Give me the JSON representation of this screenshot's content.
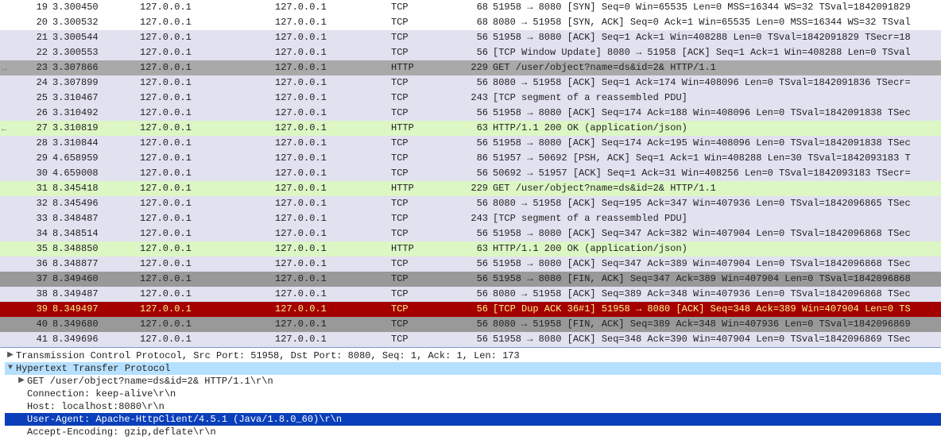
{
  "packets": [
    {
      "no": 19,
      "time": "3.300450",
      "src": "127.0.0.1",
      "dst": "127.0.0.1",
      "proto": "TCP",
      "len": 68,
      "info": "51958 → 8080 [SYN] Seq=0 Win=65535 Len=0 MSS=16344 WS=32 TSval=1842091829",
      "bg": "default"
    },
    {
      "no": 20,
      "time": "3.300532",
      "src": "127.0.0.1",
      "dst": "127.0.0.1",
      "proto": "TCP",
      "len": 68,
      "info": "8080 → 51958 [SYN, ACK] Seq=0 Ack=1 Win=65535 Len=0 MSS=16344 WS=32 TSval",
      "bg": "default"
    },
    {
      "no": 21,
      "time": "3.300544",
      "src": "127.0.0.1",
      "dst": "127.0.0.1",
      "proto": "TCP",
      "len": 56,
      "info": "51958 → 8080 [ACK] Seq=1 Ack=1 Win=408288 Len=0 TSval=1842091829 TSecr=18",
      "bg": "alt"
    },
    {
      "no": 22,
      "time": "3.300553",
      "src": "127.0.0.1",
      "dst": "127.0.0.1",
      "proto": "TCP",
      "len": 56,
      "info": "[TCP Window Update] 8080 → 51958 [ACK] Seq=1 Ack=1 Win=408288 Len=0 TSval",
      "bg": "alt"
    },
    {
      "no": 23,
      "time": "3.307866",
      "src": "127.0.0.1",
      "dst": "127.0.0.1",
      "proto": "HTTP",
      "len": 229,
      "info": "GET /user/object?name=ds&id=2& HTTP/1.1",
      "bg": "sel",
      "arrow": "→"
    },
    {
      "no": 24,
      "time": "3.307899",
      "src": "127.0.0.1",
      "dst": "127.0.0.1",
      "proto": "TCP",
      "len": 56,
      "info": "8080 → 51958 [ACK] Seq=1 Ack=174 Win=408096 Len=0 TSval=1842091836 TSecr=",
      "bg": "alt"
    },
    {
      "no": 25,
      "time": "3.310467",
      "src": "127.0.0.1",
      "dst": "127.0.0.1",
      "proto": "TCP",
      "len": 243,
      "info": "[TCP segment of a reassembled PDU]",
      "bg": "alt"
    },
    {
      "no": 26,
      "time": "3.310492",
      "src": "127.0.0.1",
      "dst": "127.0.0.1",
      "proto": "TCP",
      "len": 56,
      "info": "51958 → 8080 [ACK] Seq=174 Ack=188 Win=408096 Len=0 TSval=1842091838 TSec",
      "bg": "alt"
    },
    {
      "no": 27,
      "time": "3.310819",
      "src": "127.0.0.1",
      "dst": "127.0.0.1",
      "proto": "HTTP",
      "len": 63,
      "info": "HTTP/1.1 200 OK  (application/json)",
      "bg": "http",
      "arrow": "←"
    },
    {
      "no": 28,
      "time": "3.310844",
      "src": "127.0.0.1",
      "dst": "127.0.0.1",
      "proto": "TCP",
      "len": 56,
      "info": "51958 → 8080 [ACK] Seq=174 Ack=195 Win=408096 Len=0 TSval=1842091838 TSec",
      "bg": "alt"
    },
    {
      "no": 29,
      "time": "4.658959",
      "src": "127.0.0.1",
      "dst": "127.0.0.1",
      "proto": "TCP",
      "len": 86,
      "info": "51957 → 50692 [PSH, ACK] Seq=1 Ack=1 Win=408288 Len=30 TSval=1842093183 T",
      "bg": "alt"
    },
    {
      "no": 30,
      "time": "4.659008",
      "src": "127.0.0.1",
      "dst": "127.0.0.1",
      "proto": "TCP",
      "len": 56,
      "info": "50692 → 51957 [ACK] Seq=1 Ack=31 Win=408256 Len=0 TSval=1842093183 TSecr=",
      "bg": "alt"
    },
    {
      "no": 31,
      "time": "8.345418",
      "src": "127.0.0.1",
      "dst": "127.0.0.1",
      "proto": "HTTP",
      "len": 229,
      "info": "GET /user/object?name=ds&id=2& HTTP/1.1",
      "bg": "http"
    },
    {
      "no": 32,
      "time": "8.345496",
      "src": "127.0.0.1",
      "dst": "127.0.0.1",
      "proto": "TCP",
      "len": 56,
      "info": "8080 → 51958 [ACK] Seq=195 Ack=347 Win=407936 Len=0 TSval=1842096865 TSec",
      "bg": "alt"
    },
    {
      "no": 33,
      "time": "8.348487",
      "src": "127.0.0.1",
      "dst": "127.0.0.1",
      "proto": "TCP",
      "len": 243,
      "info": "[TCP segment of a reassembled PDU]",
      "bg": "alt"
    },
    {
      "no": 34,
      "time": "8.348514",
      "src": "127.0.0.1",
      "dst": "127.0.0.1",
      "proto": "TCP",
      "len": 56,
      "info": "51958 → 8080 [ACK] Seq=347 Ack=382 Win=407904 Len=0 TSval=1842096868 TSec",
      "bg": "alt"
    },
    {
      "no": 35,
      "time": "8.348850",
      "src": "127.0.0.1",
      "dst": "127.0.0.1",
      "proto": "HTTP",
      "len": 63,
      "info": "HTTP/1.1 200 OK  (application/json)",
      "bg": "http"
    },
    {
      "no": 36,
      "time": "8.348877",
      "src": "127.0.0.1",
      "dst": "127.0.0.1",
      "proto": "TCP",
      "len": 56,
      "info": "51958 → 8080 [ACK] Seq=347 Ack=389 Win=407904 Len=0 TSval=1842096868 TSec",
      "bg": "alt"
    },
    {
      "no": 37,
      "time": "8.349460",
      "src": "127.0.0.1",
      "dst": "127.0.0.1",
      "proto": "TCP",
      "len": 56,
      "info": "51958 → 8080 [FIN, ACK] Seq=347 Ack=389 Win=407904 Len=0 TSval=1842096868",
      "bg": "gray"
    },
    {
      "no": 38,
      "time": "8.349487",
      "src": "127.0.0.1",
      "dst": "127.0.0.1",
      "proto": "TCP",
      "len": 56,
      "info": "8080 → 51958 [ACK] Seq=389 Ack=348 Win=407936 Len=0 TSval=1842096868 TSec",
      "bg": "alt"
    },
    {
      "no": 39,
      "time": "8.349497",
      "src": "127.0.0.1",
      "dst": "127.0.0.1",
      "proto": "TCP",
      "len": 56,
      "info": "[TCP Dup ACK 36#1] 51958 → 8080 [ACK] Seq=348 Ack=389 Win=407904 Len=0 TS",
      "bg": "red"
    },
    {
      "no": 40,
      "time": "8.349680",
      "src": "127.0.0.1",
      "dst": "127.0.0.1",
      "proto": "TCP",
      "len": 56,
      "info": "8080 → 51958 [FIN, ACK] Seq=389 Ack=348 Win=407936 Len=0 TSval=1842096869",
      "bg": "gray"
    },
    {
      "no": 41,
      "time": "8.349696",
      "src": "127.0.0.1",
      "dst": "127.0.0.1",
      "proto": "TCP",
      "len": 56,
      "info": "51958 → 8080 [ACK] Seq=348 Ack=390 Win=407904 Len=0 TSval=1842096869 TSec",
      "bg": "alt"
    }
  ],
  "details": {
    "tcp_line": "Transmission Control Protocol, Src Port: 51958, Dst Port: 8080, Seq: 1, Ack: 1, Len: 173",
    "http_title": "Hypertext Transfer Protocol",
    "http": {
      "request_line": "GET /user/object?name=ds&id=2& HTTP/1.1\\r\\n",
      "connection": "Connection: keep-alive\\r\\n",
      "host": "Host: localhost:8080\\r\\n",
      "user_agent": "User-Agent: Apache-HttpClient/4.5.1 (Java/1.8.0_60)\\r\\n",
      "accept_encoding": "Accept-Encoding: gzip,deflate\\r\\n"
    }
  }
}
